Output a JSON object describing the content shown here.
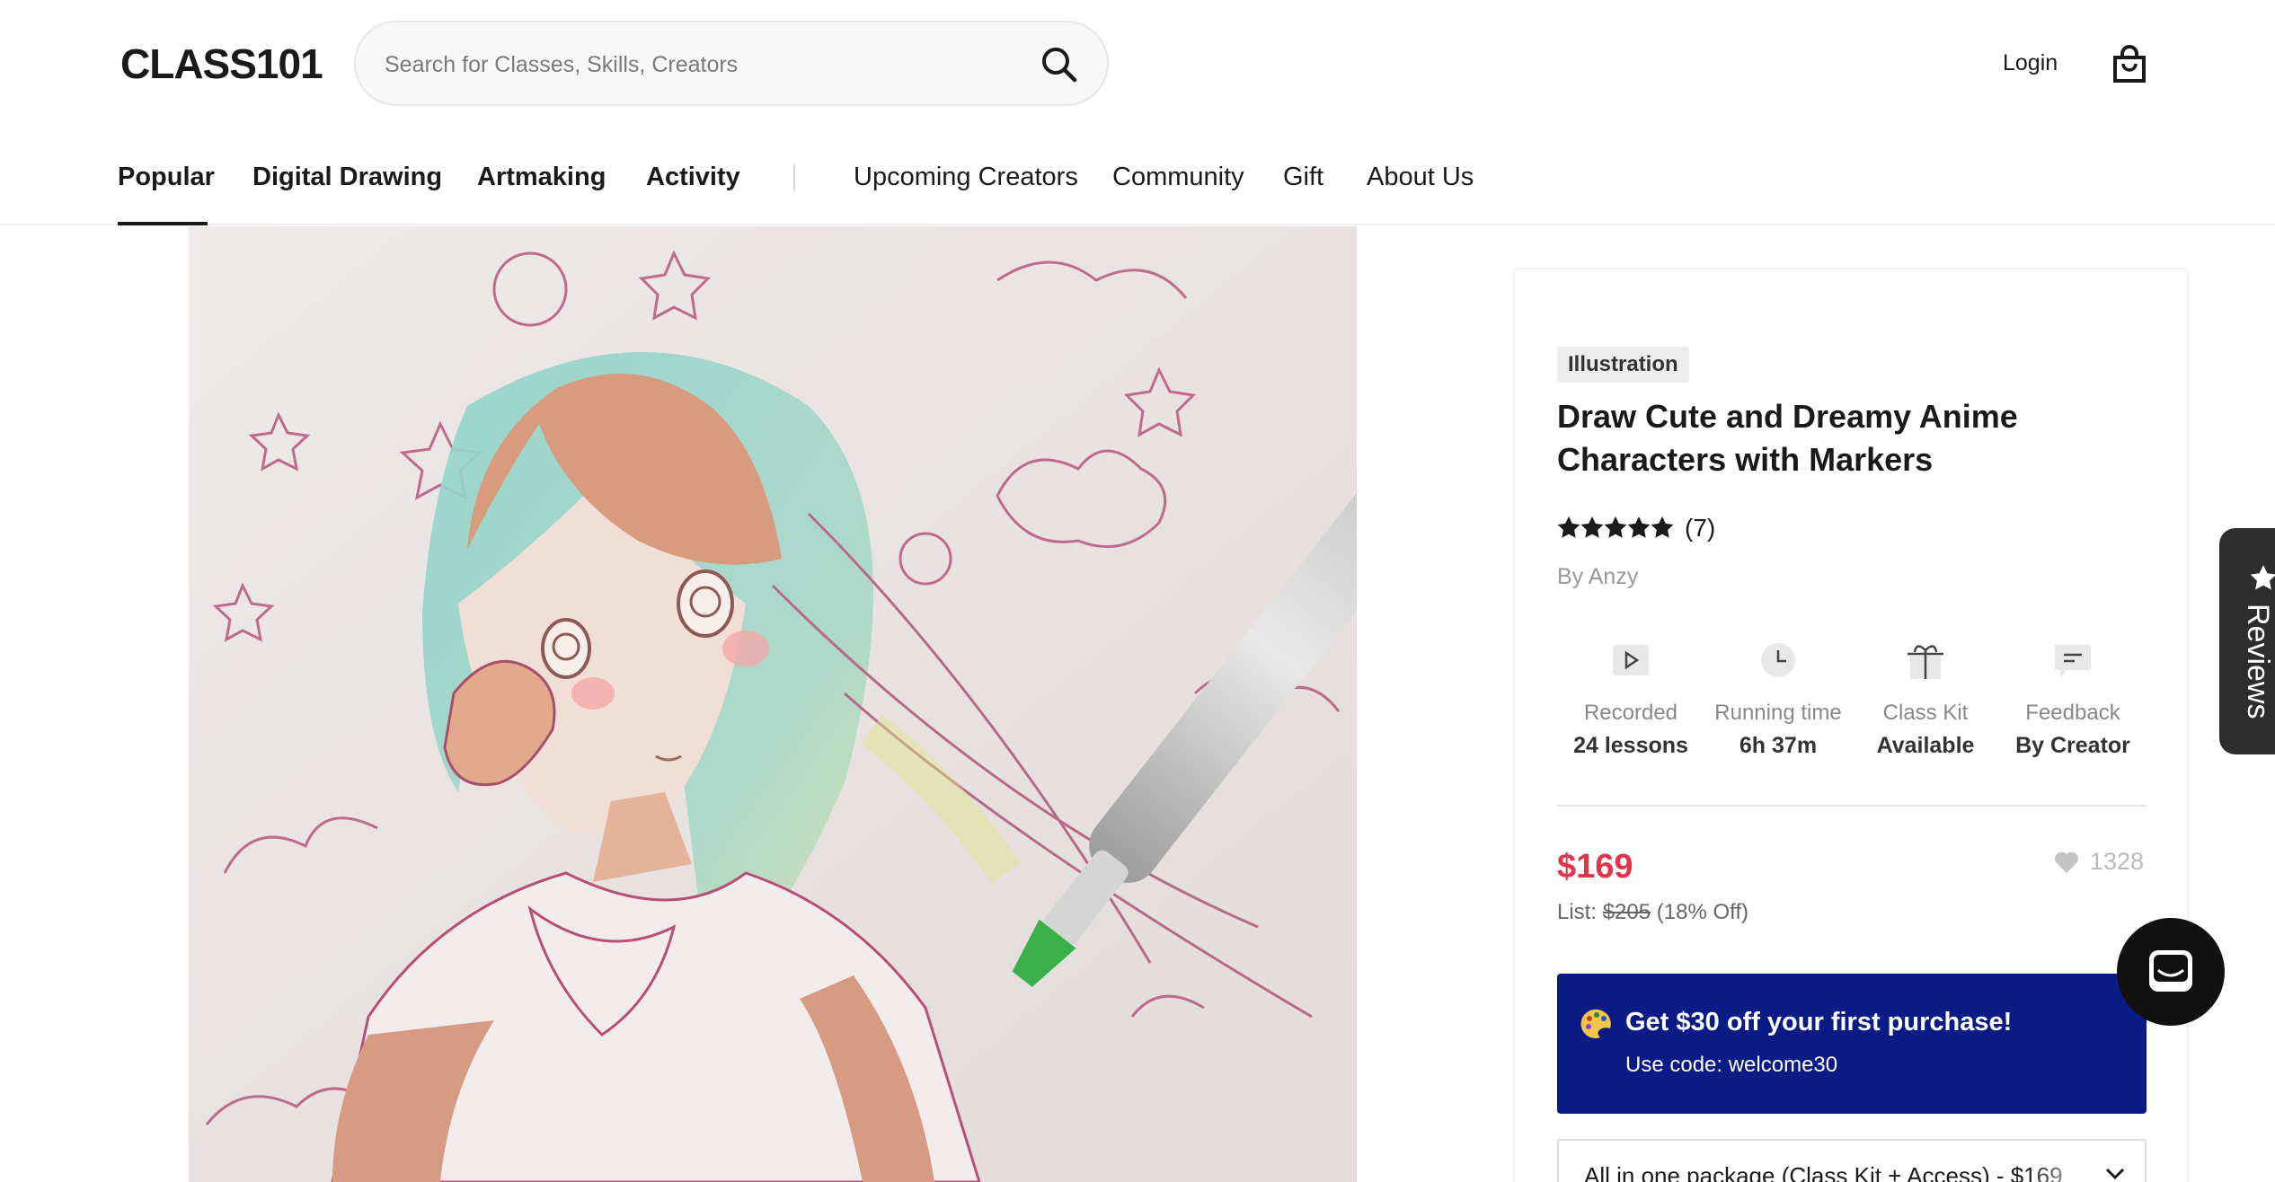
{
  "header": {
    "logo": "CLASS101",
    "search_placeholder": "Search for Classes, Skills, Creators",
    "login_label": "Login"
  },
  "nav": {
    "primary": [
      {
        "label": "Popular",
        "active": true
      },
      {
        "label": "Digital Drawing"
      },
      {
        "label": "Artmaking"
      },
      {
        "label": "Activity"
      }
    ],
    "secondary": [
      {
        "label": "Upcoming Creators"
      },
      {
        "label": "Community"
      },
      {
        "label": "Gift"
      },
      {
        "label": "About Us"
      }
    ]
  },
  "product": {
    "category": "Illustration",
    "title": "Draw Cute and Dreamy Anime Characters with Markers",
    "rating_stars": 5,
    "rating_count": "(7)",
    "creator": "By Anzy",
    "stats": [
      {
        "icon": "play-icon",
        "label": "Recorded",
        "value": "24 lessons"
      },
      {
        "icon": "clock-icon",
        "label": "Running time",
        "value": "6h 37m"
      },
      {
        "icon": "gift-icon",
        "label": "Class Kit",
        "value": "Available"
      },
      {
        "icon": "feedback-icon",
        "label": "Feedback",
        "value": "By Creator"
      }
    ],
    "price": "$169",
    "list_label": "List:",
    "list_price": "$205",
    "discount": "(18% Off)",
    "likes": "1328",
    "promo_title": "Get $30 off your first purchase!",
    "promo_code": "Use code: welcome30",
    "package_text": "All in one package (Class Kit + Access) - $169"
  },
  "side": {
    "reviews_label": "Reviews"
  },
  "colors": {
    "price": "#e0354b",
    "promo_bg": "#0b1b85",
    "text": "#1a1a1a"
  }
}
